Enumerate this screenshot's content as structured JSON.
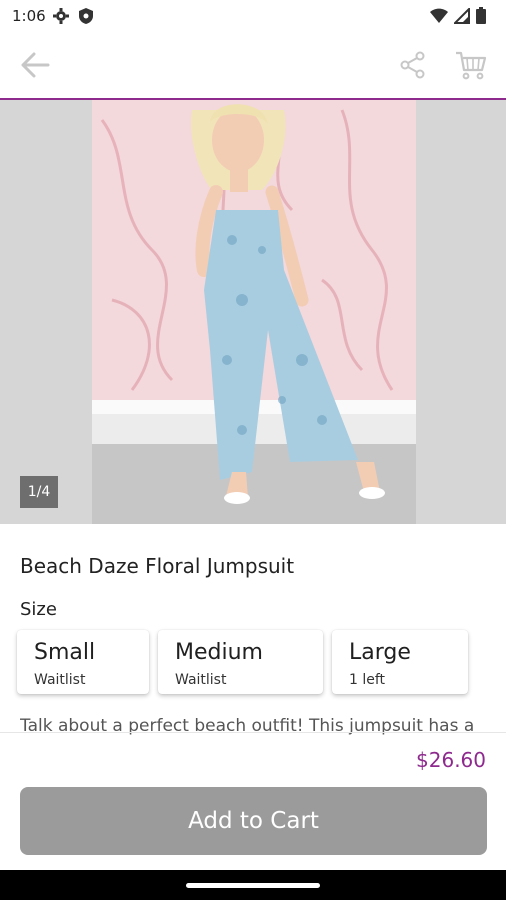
{
  "status_bar": {
    "time": "1:06"
  },
  "app_bar": {
    "back_icon": "back-arrow-icon",
    "share_icon": "share-icon",
    "cart_icon": "cart-icon",
    "accent_color": "#8e2a8e"
  },
  "gallery": {
    "indicator": "1/4"
  },
  "product": {
    "title": "Beach Daze Floral Jumpsuit",
    "size_label": "Size",
    "sizes": [
      {
        "name": "Small",
        "status": "Waitlist"
      },
      {
        "name": "Medium",
        "status": "Waitlist"
      },
      {
        "name": "Large",
        "status": "1 left"
      }
    ],
    "description": "Talk about a perfect beach outfit! This jumpsuit has a",
    "price": "$26.60"
  },
  "actions": {
    "add_to_cart": "Add to Cart"
  }
}
